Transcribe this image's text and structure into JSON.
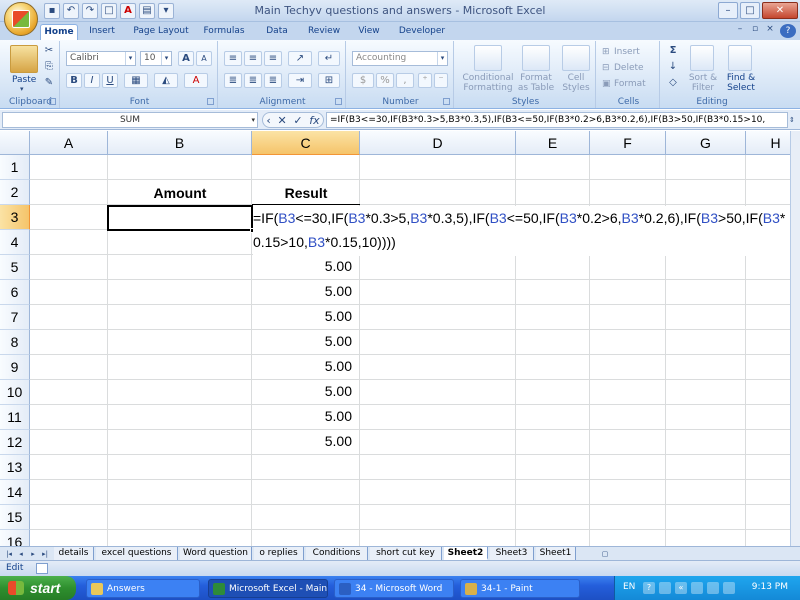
{
  "window": {
    "title": "Main Techyv questions and answers - Microsoft Excel"
  },
  "ribbon_tabs": [
    "Home",
    "Insert",
    "Page Layout",
    "Formulas",
    "Data",
    "Review",
    "View",
    "Developer"
  ],
  "ribbon": {
    "clipboard": {
      "label": "Clipboard",
      "paste": "Paste"
    },
    "font": {
      "label": "Font",
      "family": "Calibri",
      "size": "10"
    },
    "alignment": {
      "label": "Alignment"
    },
    "number": {
      "label": "Number",
      "format": "Accounting"
    },
    "styles": {
      "label": "Styles",
      "conditional": "Conditional\nFormatting",
      "format_table": "Format\nas Table",
      "cell_styles": "Cell\nStyles"
    },
    "cells": {
      "label": "Cells",
      "insert": "Insert",
      "delete": "Delete",
      "format": "Format"
    },
    "editing": {
      "label": "Editing",
      "sort": "Sort &\nFilter",
      "find": "Find &\nSelect"
    }
  },
  "formula_bar": {
    "name_box": "SUM",
    "formula": "=IF(B3<=30,IF(B3*0.3>5,B3*0.3,5),IF(B3<=50,IF(B3*0.2>6,B3*0.2,6),IF(B3>50,IF(B3*0.15>10,"
  },
  "columns": [
    "A",
    "B",
    "C",
    "D",
    "E",
    "F",
    "G",
    "H"
  ],
  "rows": [
    "1",
    "2",
    "3",
    "4",
    "5",
    "6",
    "7",
    "8",
    "9",
    "10",
    "11",
    "12",
    "13",
    "14",
    "15",
    "16"
  ],
  "cells": {
    "B2": "Amount",
    "C2": "Result",
    "results": [
      "5.00",
      "5.00",
      "5.00",
      "5.00",
      "5.00",
      "5.00",
      "5.00",
      "5.00"
    ]
  },
  "edit_overlay": {
    "line1_prefix": "=IF(",
    "line1": [
      {
        "t": "B3",
        "r": true
      },
      {
        "t": "<=30,IF(",
        "r": false
      },
      {
        "t": "B3",
        "r": true
      },
      {
        "t": "*0.3>5,",
        "r": false
      },
      {
        "t": "B3",
        "r": true
      },
      {
        "t": "*0.3,5),IF(",
        "r": false
      },
      {
        "t": "B3",
        "r": true
      },
      {
        "t": "<=50,IF(",
        "r": false
      },
      {
        "t": "B3",
        "r": true
      },
      {
        "t": "*0.2>6,",
        "r": false
      },
      {
        "t": "B3",
        "r": true
      },
      {
        "t": "*0.2,6),IF(",
        "r": false
      },
      {
        "t": "B3",
        "r": true
      },
      {
        "t": ">50,IF(",
        "r": false
      },
      {
        "t": "B3",
        "r": true
      },
      {
        "t": "*",
        "r": false
      }
    ],
    "line2": [
      {
        "t": "0.15>10,",
        "r": false
      },
      {
        "t": "B3",
        "r": true
      },
      {
        "t": "*0.15,10))))",
        "r": false
      }
    ]
  },
  "sheet_tabs": [
    "details",
    "excel questions",
    "Word question",
    "o replies",
    "Conditions",
    "short cut key",
    "Sheet2",
    "Sheet3",
    "Sheet1"
  ],
  "active_sheet": "Sheet2",
  "status": {
    "mode": "Edit"
  },
  "taskbar": {
    "start": "start",
    "buttons": [
      "Answers",
      "Microsoft Excel - Main...",
      "34 - Microsoft Word",
      "34-1 - Paint"
    ],
    "active": "Microsoft Excel - Main...",
    "lang": "EN",
    "clock": "9:13 PM"
  }
}
